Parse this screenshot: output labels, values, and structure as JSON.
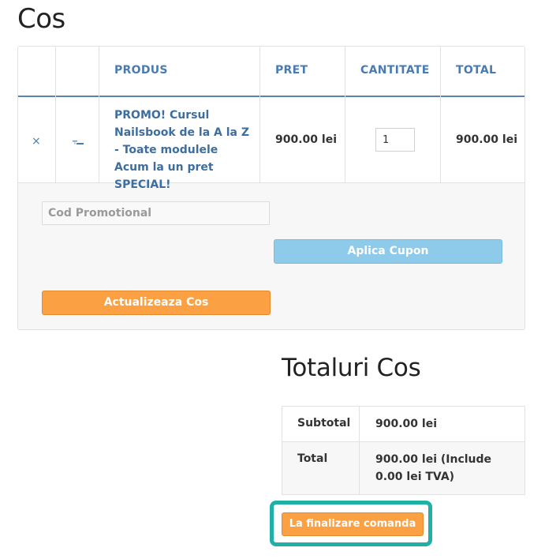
{
  "page": {
    "title": "Cos"
  },
  "cart": {
    "headers": {
      "product": "PRODUS",
      "price": "PRET",
      "quantity": "CANTITATE",
      "total": "TOTAL"
    },
    "items": [
      {
        "remove_icon": "×",
        "thumbnail_icon": "product-thumbnail-icon",
        "name": "PROMO! Cursul Nailsbook de la A la Z - Toate modulele Acum la un pret SPECIAL!",
        "price": "900.00 lei",
        "quantity": "1",
        "total": "900.00 lei"
      }
    ],
    "coupon": {
      "placeholder": "Cod Promotional",
      "apply_label": "Aplica Cupon"
    },
    "update_label": "Actualizeaza Cos"
  },
  "totals": {
    "title": "Totaluri Cos",
    "subtotal_label": "Subtotal",
    "subtotal_value": "900.00 lei",
    "total_label": "Total",
    "total_value": "900.00 lei (Include 0.00 lei TVA)",
    "checkout_label": "La finalizare comanda"
  },
  "colors": {
    "link_blue": "#4a7bb0",
    "header_border": "#5a83ad",
    "apply_button": "#8ecbea",
    "orange_button": "#fba143",
    "highlight_frame": "#21b0a8"
  }
}
